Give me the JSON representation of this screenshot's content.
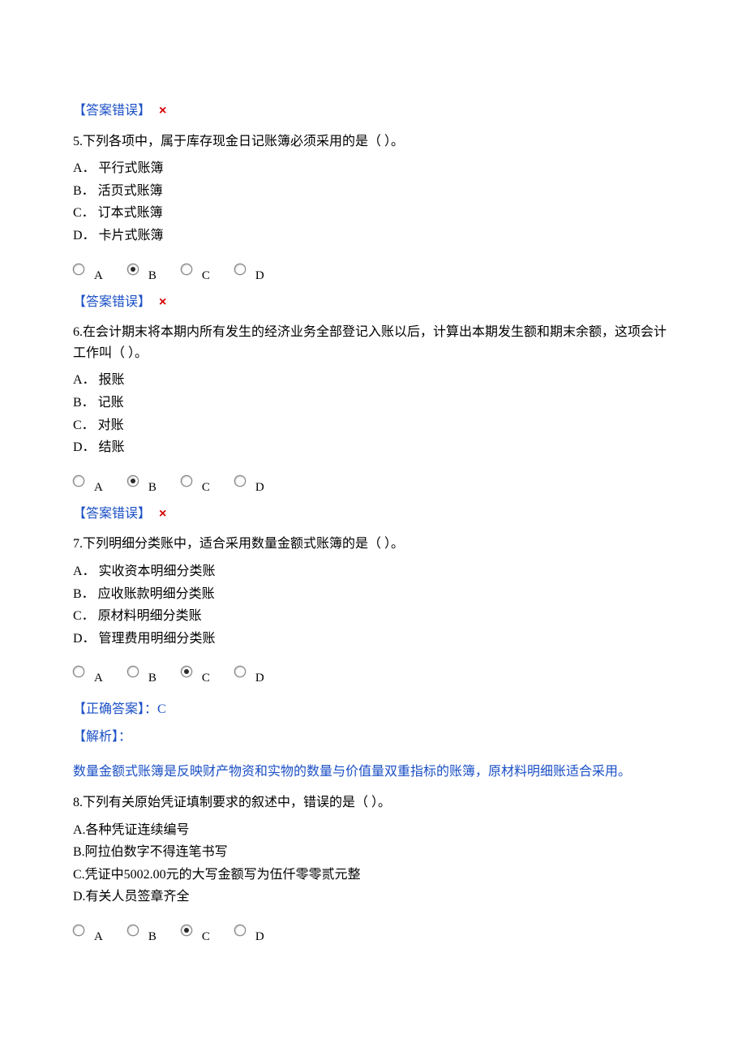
{
  "wrong_label": "【答案错误】",
  "cross_symbol": "×",
  "correct_label_prefix": "【正确答案】：",
  "analysis_label": "【解析】：",
  "q5": {
    "text": "5.下列各项中，属于库存现金日记账簿必须采用的是（ ）。",
    "opts": {
      "a": "A． 平行式账簿",
      "b": "B． 活页式账簿",
      "c": "C． 订本式账簿",
      "d": "D． 卡片式账簿"
    },
    "radios": {
      "a": "A",
      "b": "B",
      "c": "C",
      "d": "D"
    },
    "selected": "b"
  },
  "q6": {
    "text": "6.在会计期末将本期内所有发生的经济业务全部登记入账以后，计算出本期发生额和期末余额，这项会计工作叫（ ）。",
    "opts": {
      "a": "A． 报账",
      "b": "B． 记账",
      "c": "C． 对账",
      "d": "D． 结账"
    },
    "radios": {
      "a": "A",
      "b": "B",
      "c": "C",
      "d": "D"
    },
    "selected": "b"
  },
  "q7": {
    "text": "7.下列明细分类账中，适合采用数量金额式账簿的是（ ）。",
    "opts": {
      "a": "A． 实收资本明细分类账",
      "b": "B． 应收账款明细分类账",
      "c": "C． 原材料明细分类账",
      "d": "D． 管理费用明细分类账"
    },
    "radios": {
      "a": "A",
      "b": "B",
      "c": "C",
      "d": "D"
    },
    "selected": "c",
    "correct_letter": "C",
    "analysis": "数量金额式账簿是反映财产物资和实物的数量与价值量双重指标的账簿，原材料明细账适合采用。"
  },
  "q8": {
    "text": "8.下列有关原始凭证填制要求的叙述中，错误的是（ ）。",
    "opts": {
      "a": "A.各种凭证连续编号",
      "b": "B.阿拉伯数字不得连笔书写",
      "c": "C.凭证中5002.00元的大写金额写为伍仟零零贰元整",
      "d": "D.有关人员签章齐全"
    },
    "radios": {
      "a": "A",
      "b": "B",
      "c": "C",
      "d": "D"
    },
    "selected": "c"
  }
}
